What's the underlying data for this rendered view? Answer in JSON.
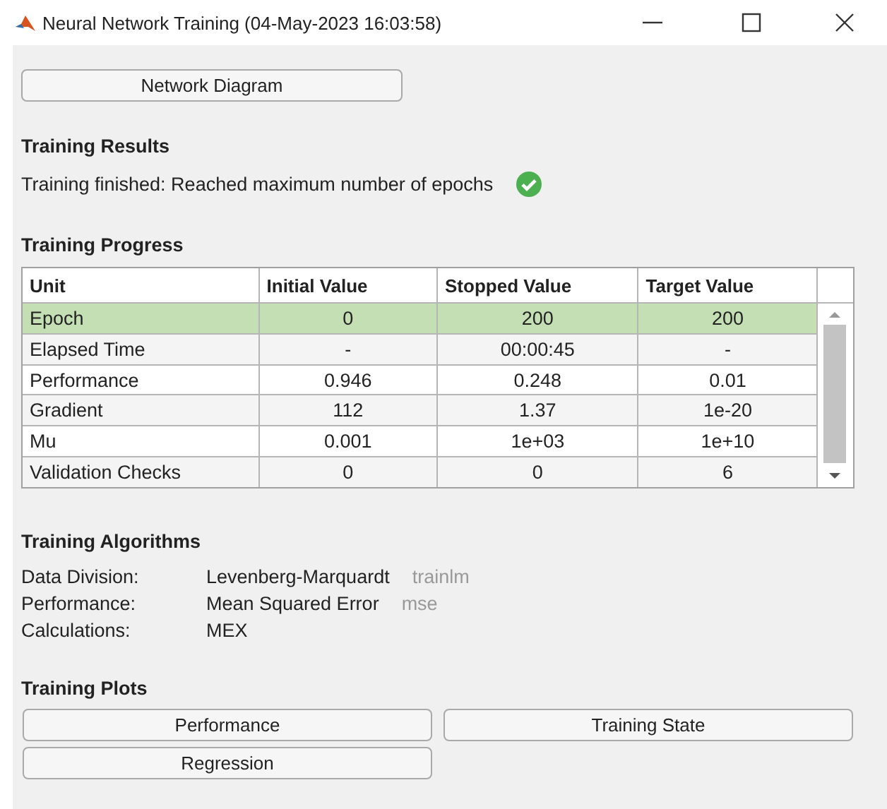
{
  "window": {
    "title": "Neural Network Training (04-May-2023 16:03:58)"
  },
  "network_button": "Network Diagram",
  "results": {
    "heading": "Training Results",
    "message": "Training finished: Reached maximum number of epochs",
    "success": true
  },
  "progress": {
    "heading": "Training Progress",
    "columns": [
      "Unit",
      "Initial Value",
      "Stopped Value",
      "Target Value"
    ],
    "rows": [
      {
        "cells": [
          "Epoch",
          "0",
          "200",
          "200"
        ],
        "selected": true
      },
      {
        "cells": [
          "Elapsed Time",
          "-",
          "00:00:45",
          "-"
        ],
        "selected": false
      },
      {
        "cells": [
          "Performance",
          "0.946",
          "0.248",
          "0.01"
        ],
        "selected": false
      },
      {
        "cells": [
          "Gradient",
          "112",
          "1.37",
          "1e-20"
        ],
        "selected": false
      },
      {
        "cells": [
          "Mu",
          "0.001",
          "1e+03",
          "1e+10"
        ],
        "selected": false
      },
      {
        "cells": [
          "Validation Checks",
          "0",
          "0",
          "6"
        ],
        "selected": false
      }
    ]
  },
  "algorithms": {
    "heading": "Training Algorithms",
    "items": [
      {
        "label": "Data Division:",
        "value": "Levenberg-Marquardt",
        "code": "trainlm"
      },
      {
        "label": "Performance:",
        "value": "Mean Squared Error",
        "code": "mse"
      },
      {
        "label": "Calculations:",
        "value": "MEX"
      }
    ]
  },
  "plots": {
    "heading": "Training Plots",
    "buttons": [
      "Performance",
      "Training State",
      "Regression"
    ]
  }
}
